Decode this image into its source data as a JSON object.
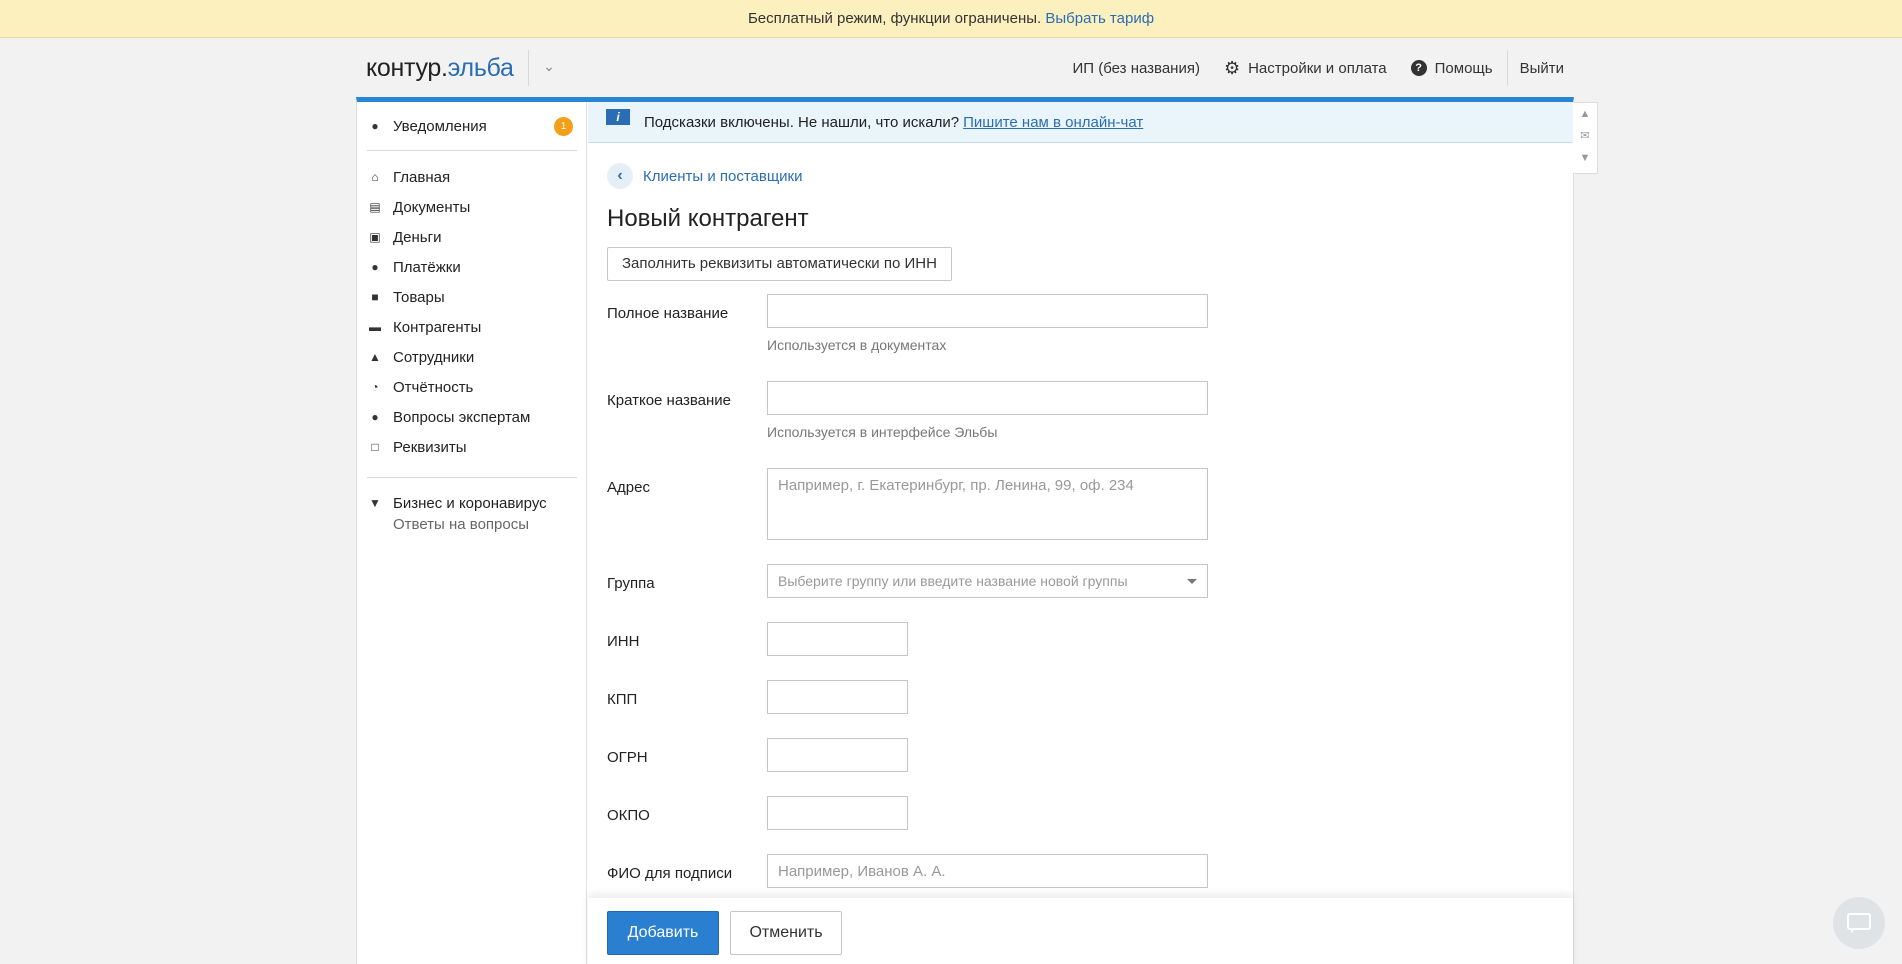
{
  "banner": {
    "text": "Бесплатный режим, функции ограничены.",
    "link": "Выбрать тариф"
  },
  "header": {
    "logo_part1": "контур.",
    "logo_part2": "эльба",
    "org": "ИП (без названия)",
    "settings": "Настройки и оплата",
    "help": "Помощь",
    "logout": "Выйти"
  },
  "sidebar": {
    "notifications": {
      "label": "Уведомления",
      "count": "1"
    },
    "items": [
      {
        "label": "Главная",
        "icon": "home-icon"
      },
      {
        "label": "Документы",
        "icon": "documents-icon"
      },
      {
        "label": "Деньги",
        "icon": "money-icon"
      },
      {
        "label": "Платёжки",
        "icon": "payments-icon"
      },
      {
        "label": "Товары",
        "icon": "cart-icon"
      },
      {
        "label": "Контрагенты",
        "icon": "briefcase-icon"
      },
      {
        "label": "Сотрудники",
        "icon": "person-icon"
      },
      {
        "label": "Отчётность",
        "icon": "reports-icon"
      },
      {
        "label": "Вопросы экспертам",
        "icon": "question-icon"
      },
      {
        "label": "Реквизиты",
        "icon": "requisites-icon"
      }
    ],
    "covid": {
      "label": "Бизнес и коронавирус",
      "sub": "Ответы на вопросы"
    }
  },
  "hint": {
    "text": "Подсказки включены. Не нашли, что искали?",
    "link": "Пишите нам в онлайн-чат"
  },
  "page": {
    "breadcrumb": "Клиенты и поставщики",
    "title": "Новый контрагент",
    "autofill_button": "Заполнить реквизиты автоматически по ИНН"
  },
  "form": {
    "full_name": {
      "label": "Полное название",
      "help": "Используется в документах",
      "value": ""
    },
    "short_name": {
      "label": "Краткое название",
      "help": "Используется в интерфейсе Эльбы",
      "value": ""
    },
    "address": {
      "label": "Адрес",
      "placeholder": "Например, г. Екатеринбург, пр. Ленина, 99, оф. 234"
    },
    "group": {
      "label": "Группа",
      "placeholder": "Выберите группу или введите название новой группы"
    },
    "inn": {
      "label": "ИНН"
    },
    "kpp": {
      "label": "КПП"
    },
    "ogrn": {
      "label": "ОГРН"
    },
    "okpo": {
      "label": "ОКПО"
    },
    "signer": {
      "label": "ФИО для подписи",
      "placeholder": "Например, Иванов А. А."
    }
  },
  "footer": {
    "add": "Добавить",
    "cancel": "Отменить"
  }
}
